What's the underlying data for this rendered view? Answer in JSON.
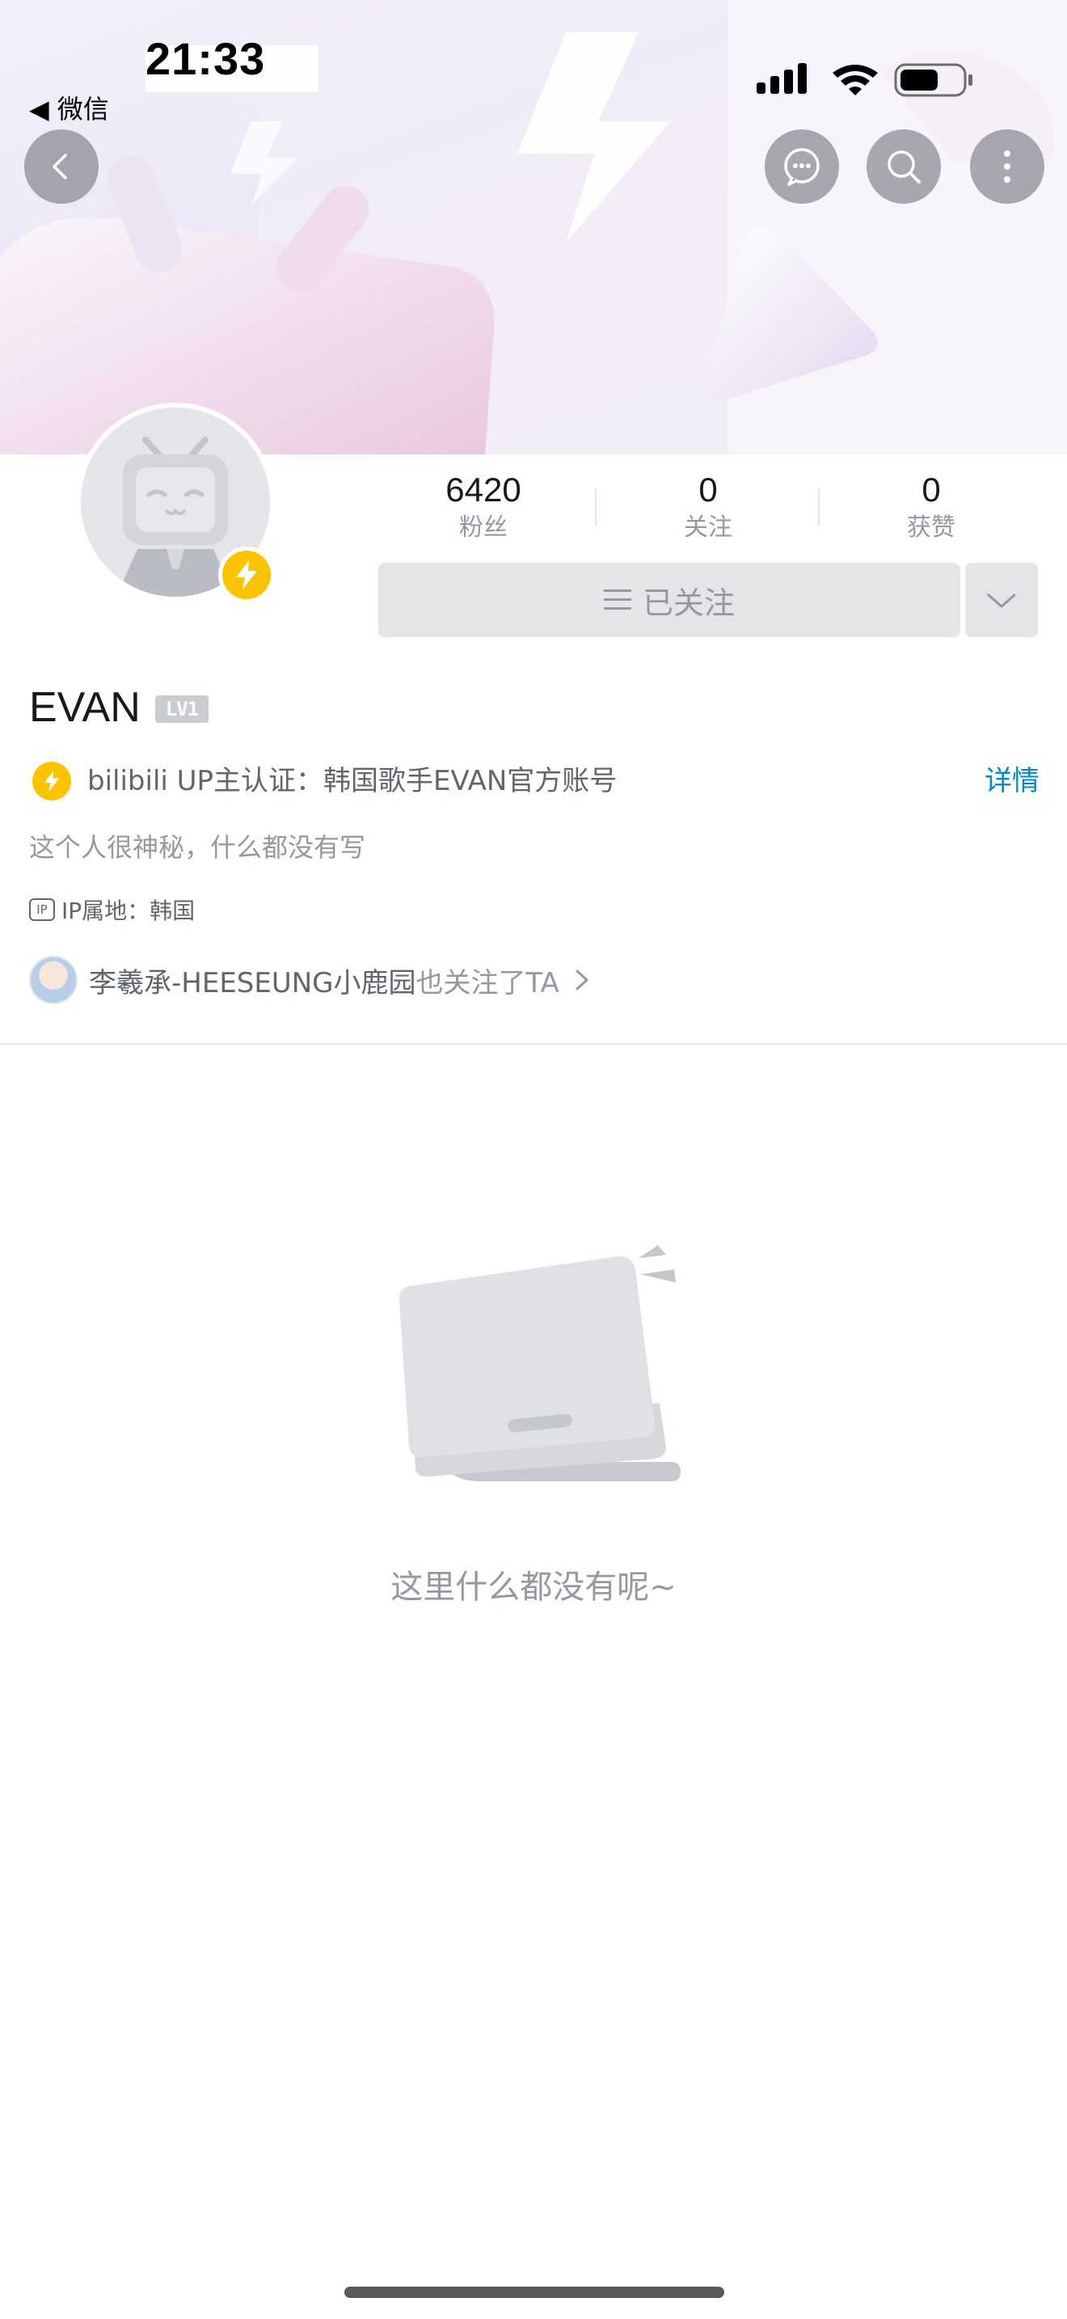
{
  "status_bar": {
    "time": "21:33",
    "back_app": "◀ 微信"
  },
  "header": {
    "back_icon": "chevron-left-icon",
    "chat_icon": "chat-bubble-icon",
    "search_icon": "search-icon",
    "more_icon": "more-vertical-icon"
  },
  "stats": {
    "fans_count": "6420",
    "fans_label": "粉丝",
    "following_count": "0",
    "following_label": "关注",
    "likes_count": "0",
    "likes_label": "获赞"
  },
  "follow_button": {
    "label": "已关注"
  },
  "profile": {
    "name": "EVAN",
    "level": "LV1",
    "verification": "bilibili UP主认证：韩国歌手EVAN官方账号",
    "verification_detail": "详情",
    "signature": "这个人很神秘，什么都没有写",
    "ip_badge": "IP",
    "ip_location": "IP属地：韩国"
  },
  "mutual": {
    "name": "李羲承-HEESEUNG小鹿园",
    "suffix": "也关注了TA"
  },
  "empty_state": {
    "text": "这里什么都没有呢~"
  },
  "colors": {
    "accent_blue": "#0088cc",
    "badge_yellow": "#fcc300",
    "text_gray": "#9499a0",
    "button_bg": "#e3e5e7"
  }
}
